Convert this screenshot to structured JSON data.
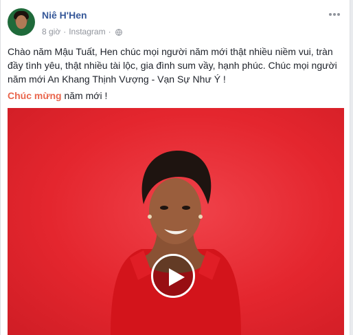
{
  "post": {
    "author": "Niê H'Hen",
    "time": "8 giờ",
    "separator": "·",
    "source": "Instagram",
    "body": "Chào năm Mậu Tuất, Hen chúc mọi người năm mới thật nhiều niềm vui, tràn đầy tình yêu, thật nhiều tài lộc, gia đình sum vầy, hạnh phúc. Chúc mọi người năm mới An Khang Thịnh Vượng - Vạn Sự Như Ý !",
    "greeting_highlight": "Chúc mừng",
    "greeting_rest": " năm mới !"
  },
  "icons": {
    "privacy": "globe-icon",
    "menu": "more-options-icon",
    "video": "play-icon"
  },
  "colors": {
    "author": "#365899",
    "highlight": "#e9664d",
    "video_background": "#e4262e"
  }
}
